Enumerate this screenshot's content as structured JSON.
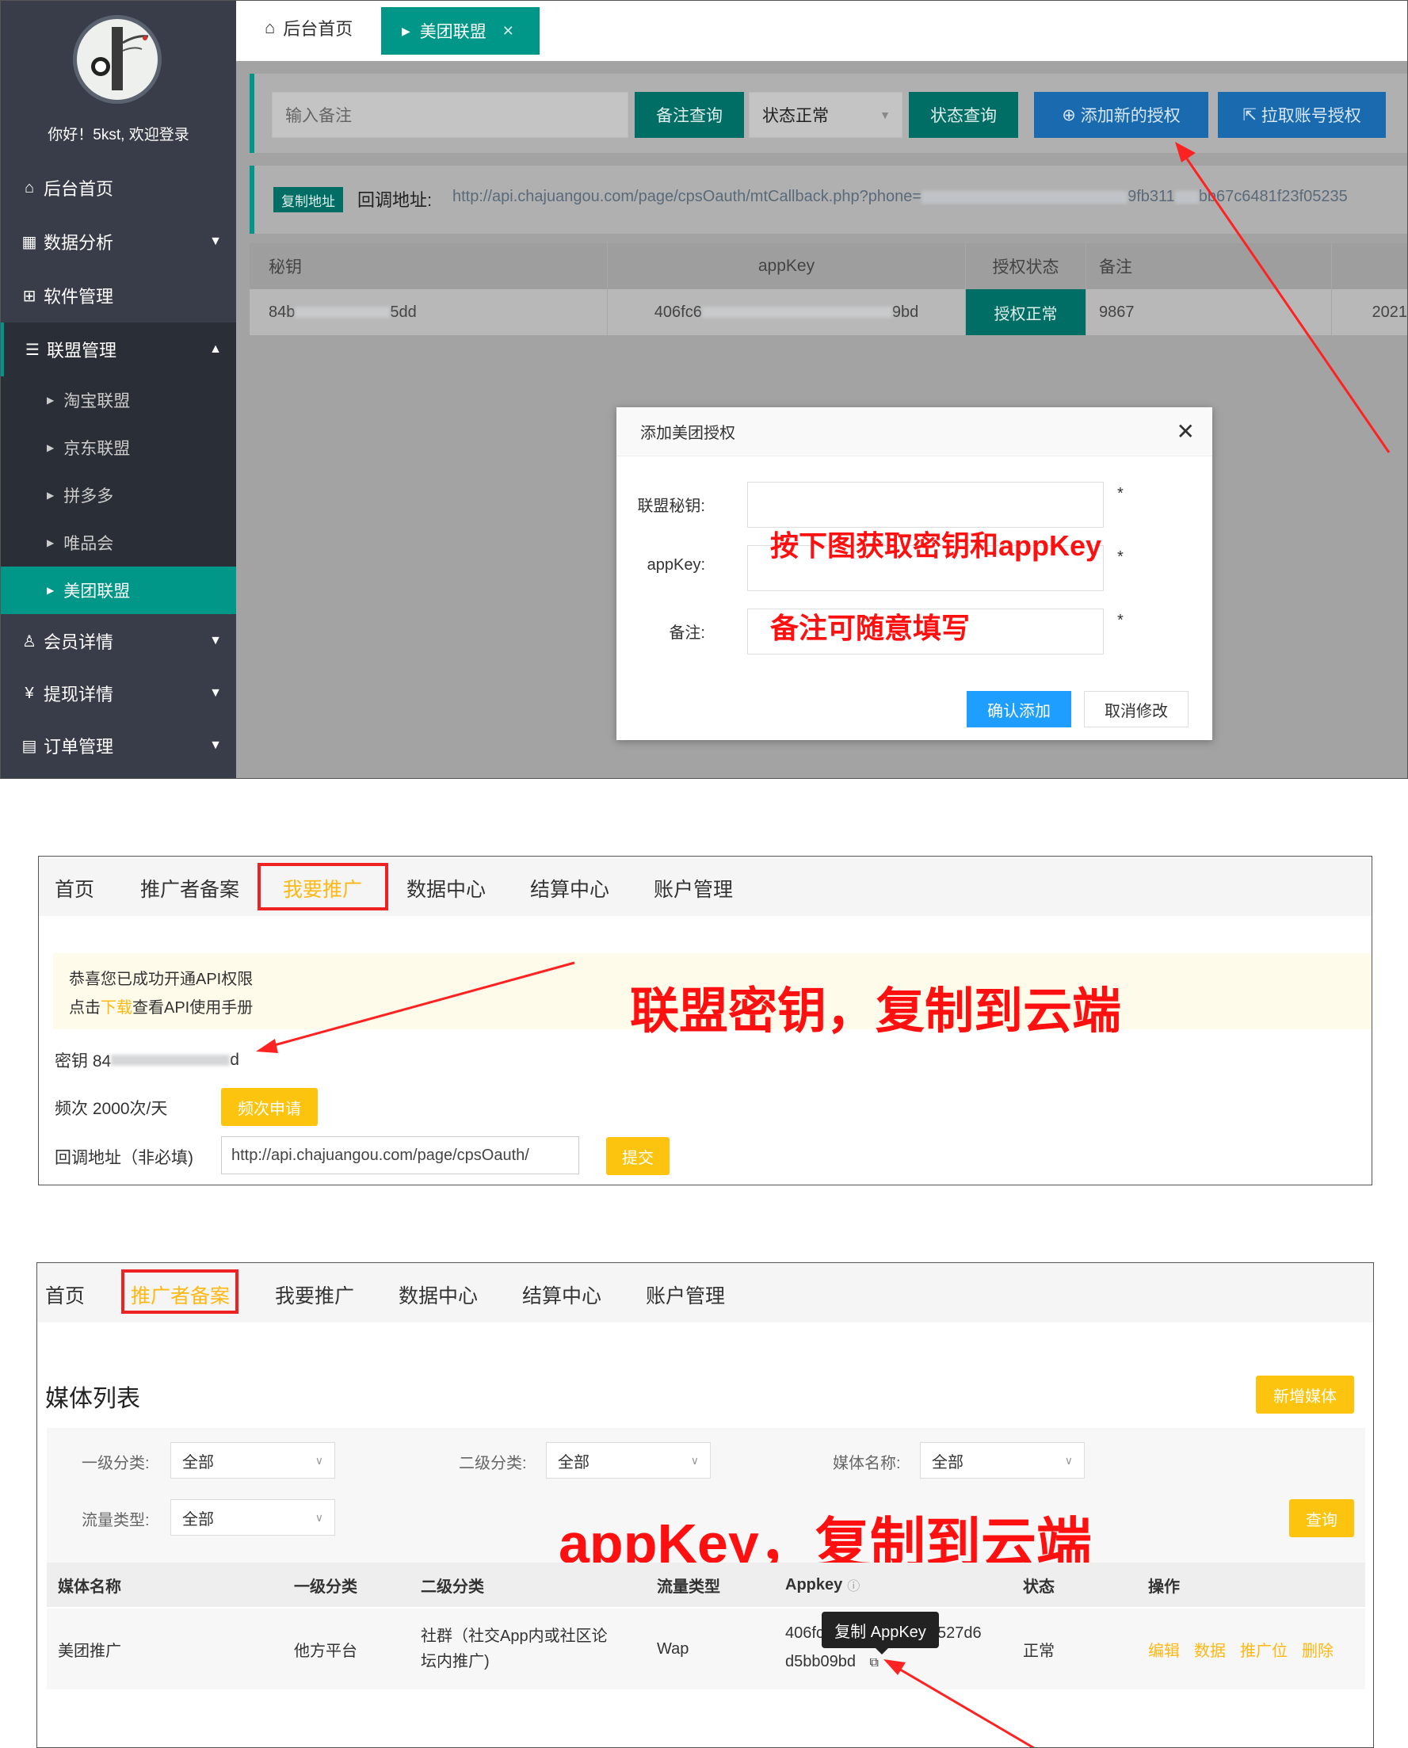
{
  "panel1": {
    "sidebar": {
      "welcome": "你好！5kst, 欢迎登录",
      "items": [
        {
          "label": "后台首页",
          "icon": "home-icon"
        },
        {
          "label": "数据分析",
          "icon": "chart-icon"
        },
        {
          "label": "软件管理",
          "icon": "apps-icon"
        },
        {
          "label": "联盟管理",
          "icon": "list-icon"
        },
        {
          "label": "会员详情",
          "icon": "user-icon"
        },
        {
          "label": "提现详情",
          "icon": "yuan-icon"
        },
        {
          "label": "订单管理",
          "icon": "grid-icon"
        }
      ],
      "sub_items": [
        "淘宝联盟",
        "京东联盟",
        "拼多多",
        "唯品会",
        "美团联盟"
      ]
    },
    "tabs": {
      "home": "后台首页",
      "active": "美团联盟"
    },
    "toolbar": {
      "note_placeholder": "输入备注",
      "note_query": "备注查询",
      "status_value": "状态正常",
      "status_query": "状态查询",
      "add_auth": "添加新的授权",
      "pull_auth": "拉取账号授权"
    },
    "callback": {
      "copy_label": "复制地址",
      "label": "回调地址:",
      "url_start": "http://api.chajuangou.com/page/cpsOauth/mtCallback.php?phone=",
      "url_end": "9fb311",
      "url_tail": "bb67c6481f23f05235"
    },
    "table": {
      "headers": [
        "秘钥",
        "appKey",
        "授权状态",
        "备注"
      ],
      "row": {
        "secret_start": "84b",
        "secret_end": "5dd",
        "appkey_start": "406fc6",
        "appkey_end": "9bd",
        "status": "授权正常",
        "note": "9867",
        "date": "2021"
      }
    },
    "modal": {
      "title": "添加美团授权",
      "fields": [
        {
          "label": "联盟秘钥:"
        },
        {
          "label": "appKey:"
        },
        {
          "label": "备注:"
        }
      ],
      "required_mark": "*",
      "annotation_1": "按下图获取密钥和appKey",
      "annotation_2": "备注可随意填写",
      "confirm": "确认添加",
      "cancel": "取消修改"
    }
  },
  "panel2": {
    "nav": [
      "首页",
      "推广者备案",
      "我要推广",
      "数据中心",
      "结算中心",
      "账户管理"
    ],
    "notice_line1": "恭喜您已成功开通API权限",
    "notice_line2_pre": "点击",
    "notice_link": "下载",
    "notice_line2_post": "查看API使用手册",
    "annotation": "联盟密钥，复制到云端",
    "secret_label": "密钥 84",
    "secret_tail": "d",
    "freq_label": "频次 2000次/天",
    "freq_button": "频次申请",
    "callback_label": "回调地址（非必填)",
    "callback_value": "http://api.chajuangou.com/page/cpsOauth/",
    "submit": "提交"
  },
  "panel3": {
    "nav": [
      "首页",
      "推广者备案",
      "我要推广",
      "数据中心",
      "结算中心",
      "账户管理"
    ],
    "title": "媒体列表",
    "add_media": "新增媒体",
    "filters": [
      {
        "label": "一级分类:",
        "value": "全部"
      },
      {
        "label": "二级分类:",
        "value": "全部"
      },
      {
        "label": "媒体名称:",
        "value": "全部"
      },
      {
        "label": "流量类型:",
        "value": "全部"
      }
    ],
    "query": "查询",
    "annotation": "appKey，复制到云端",
    "headers": [
      "媒体名称",
      "一级分类",
      "二级分类",
      "流量类型",
      "Appkey",
      "状态",
      "操作"
    ],
    "row": {
      "name": "美团推广",
      "cat1": "他方平台",
      "cat2": "社群（社交App内或社区论坛内推广)",
      "traffic": "Wap",
      "appkey_start": "406fc",
      "appkey_mid": "1527d6",
      "appkey_line2": "d5bb09bd",
      "status": "正常",
      "ops": [
        "编辑",
        "数据",
        "推广位",
        "删除"
      ]
    },
    "tooltip": "复制 AppKey"
  },
  "colors": {
    "teal": "#009688",
    "sidebar": "#393d49",
    "red_annotation": "#ff1010",
    "orange": "#fdb813",
    "blue": "#1e9fff"
  }
}
